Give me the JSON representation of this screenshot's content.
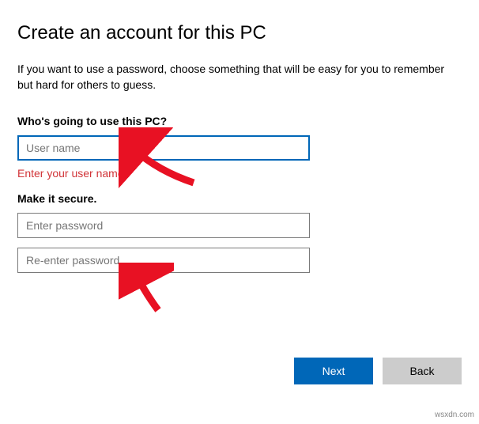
{
  "title": "Create an account for this PC",
  "description": "If you want to use a password, choose something that will be easy for you to remember but hard for others to guess.",
  "username_section": {
    "label": "Who's going to use this PC?",
    "placeholder": "User name",
    "value": "",
    "error": "Enter your user name."
  },
  "password_section": {
    "label": "Make it secure.",
    "password_placeholder": "Enter password",
    "confirm_placeholder": "Re-enter password",
    "password_value": "",
    "confirm_value": ""
  },
  "buttons": {
    "next": "Next",
    "back": "Back"
  },
  "watermark": "wsxdn.com",
  "colors": {
    "primary": "#0067b8",
    "error": "#d13438",
    "secondary_btn": "#cccccc"
  }
}
